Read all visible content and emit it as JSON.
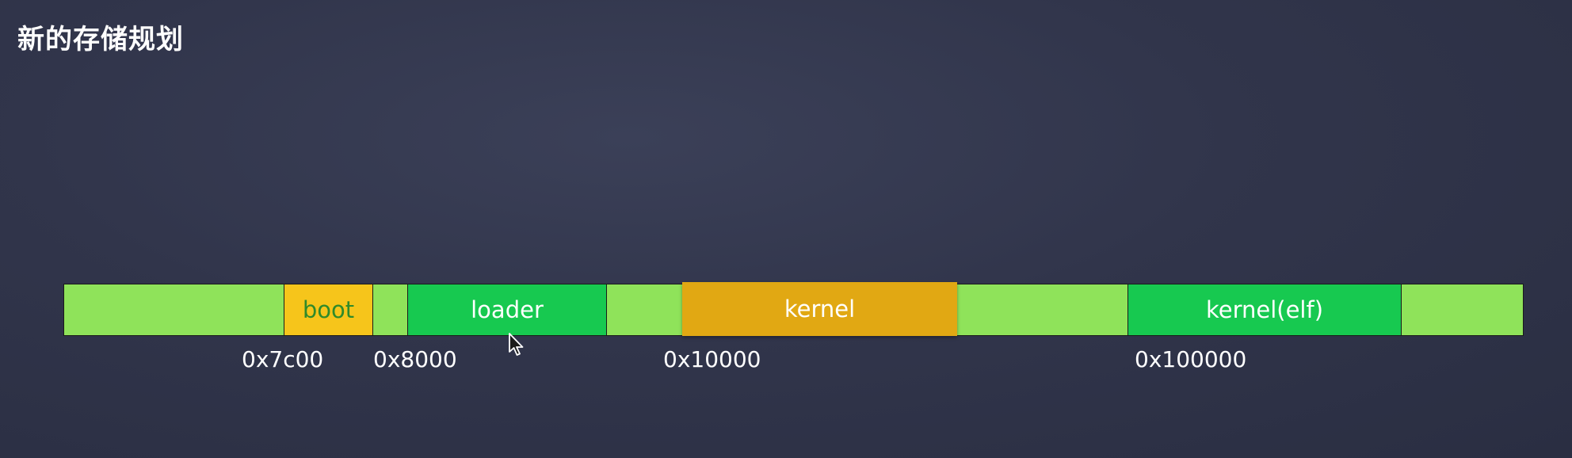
{
  "slide": {
    "title": "新的存储规划"
  },
  "memory_map": {
    "segments": [
      {
        "label": "",
        "kind": "free"
      },
      {
        "label": "boot",
        "kind": "boot"
      },
      {
        "label": "",
        "kind": "free"
      },
      {
        "label": "loader",
        "kind": "used"
      },
      {
        "label": "",
        "kind": "free"
      },
      {
        "label": "kernel",
        "kind": "kernel"
      },
      {
        "label": "",
        "kind": "free"
      },
      {
        "label": "kernel(elf)",
        "kind": "used"
      },
      {
        "label": "",
        "kind": "free"
      }
    ],
    "addresses": [
      "0x7c00",
      "0x8000",
      "0x10000",
      "0x100000"
    ]
  },
  "colors": {
    "background": "#31354b",
    "free": "#8fe35a",
    "boot": "#f6c51b",
    "used": "#17c950",
    "kernel": "#e1a813",
    "boot_text": "#2f8a2a"
  },
  "icons": {
    "cursor": "mouse-pointer-icon"
  }
}
